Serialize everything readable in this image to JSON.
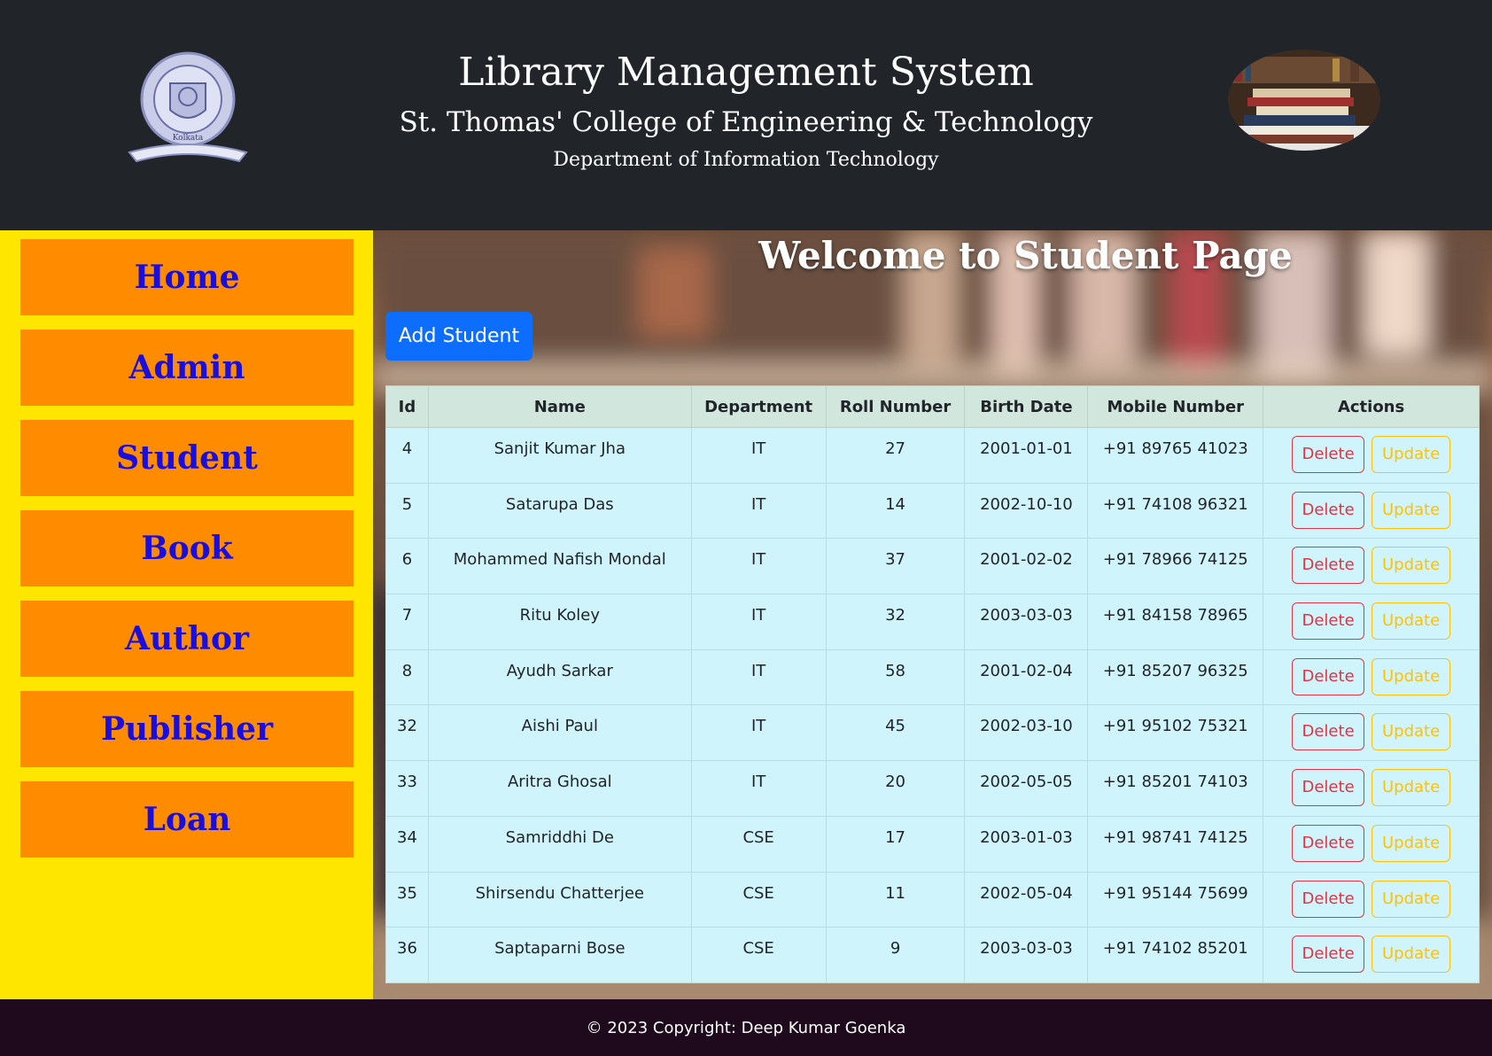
{
  "header": {
    "title": "Library Management System",
    "college": "St. Thomas' College of Engineering & Technology",
    "department": "Department of Information Technology",
    "logo_text": "Kolkata"
  },
  "sidebar": {
    "items": [
      {
        "label": "Home"
      },
      {
        "label": "Admin"
      },
      {
        "label": "Student"
      },
      {
        "label": "Book"
      },
      {
        "label": "Author"
      },
      {
        "label": "Publisher"
      },
      {
        "label": "Loan"
      }
    ]
  },
  "main": {
    "welcome": "Welcome to Student Page",
    "add_button": "Add Student"
  },
  "table": {
    "headers": [
      "Id",
      "Name",
      "Department",
      "Roll Number",
      "Birth Date",
      "Mobile Number",
      "Actions"
    ],
    "delete_label": "Delete",
    "update_label": "Update",
    "rows": [
      [
        "4",
        "Sanjit Kumar Jha",
        "IT",
        "27",
        "2001-01-01",
        "+91 89765 41023"
      ],
      [
        "5",
        "Satarupa Das",
        "IT",
        "14",
        "2002-10-10",
        "+91 74108 96321"
      ],
      [
        "6",
        "Mohammed Nafish Mondal",
        "IT",
        "37",
        "2001-02-02",
        "+91 78966 74125"
      ],
      [
        "7",
        "Ritu Koley",
        "IT",
        "32",
        "2003-03-03",
        "+91 84158 78965"
      ],
      [
        "8",
        "Ayudh Sarkar",
        "IT",
        "58",
        "2001-02-04",
        "+91 85207 96325"
      ],
      [
        "32",
        "Aishi Paul",
        "IT",
        "45",
        "2002-03-10",
        "+91 95102 75321"
      ],
      [
        "33",
        "Aritra Ghosal",
        "IT",
        "20",
        "2002-05-05",
        "+91 85201 74103"
      ],
      [
        "34",
        "Samriddhi De",
        "CSE",
        "17",
        "2003-01-03",
        "+91 98741 74125"
      ],
      [
        "35",
        "Shirsendu Chatterjee",
        "CSE",
        "11",
        "2002-05-04",
        "+91 95144 75699"
      ],
      [
        "36",
        "Saptaparni Bose",
        "CSE",
        "9",
        "2003-03-03",
        "+91 74102 85201"
      ]
    ]
  },
  "footer": {
    "copyright": "© 2023 Copyright: Deep Kumar Goenka"
  },
  "colors": {
    "header_bg": "#212529",
    "sidebar_bg": "#ffe600",
    "nav_button_bg": "#ff8c00",
    "nav_text": "#1a0de0",
    "primary": "#0d6efd",
    "danger": "#dc3545",
    "warning": "#ffc107",
    "table_head": "#d1e7dd",
    "table_row": "#cff4fc",
    "footer_bg": "#1f0a1d"
  }
}
